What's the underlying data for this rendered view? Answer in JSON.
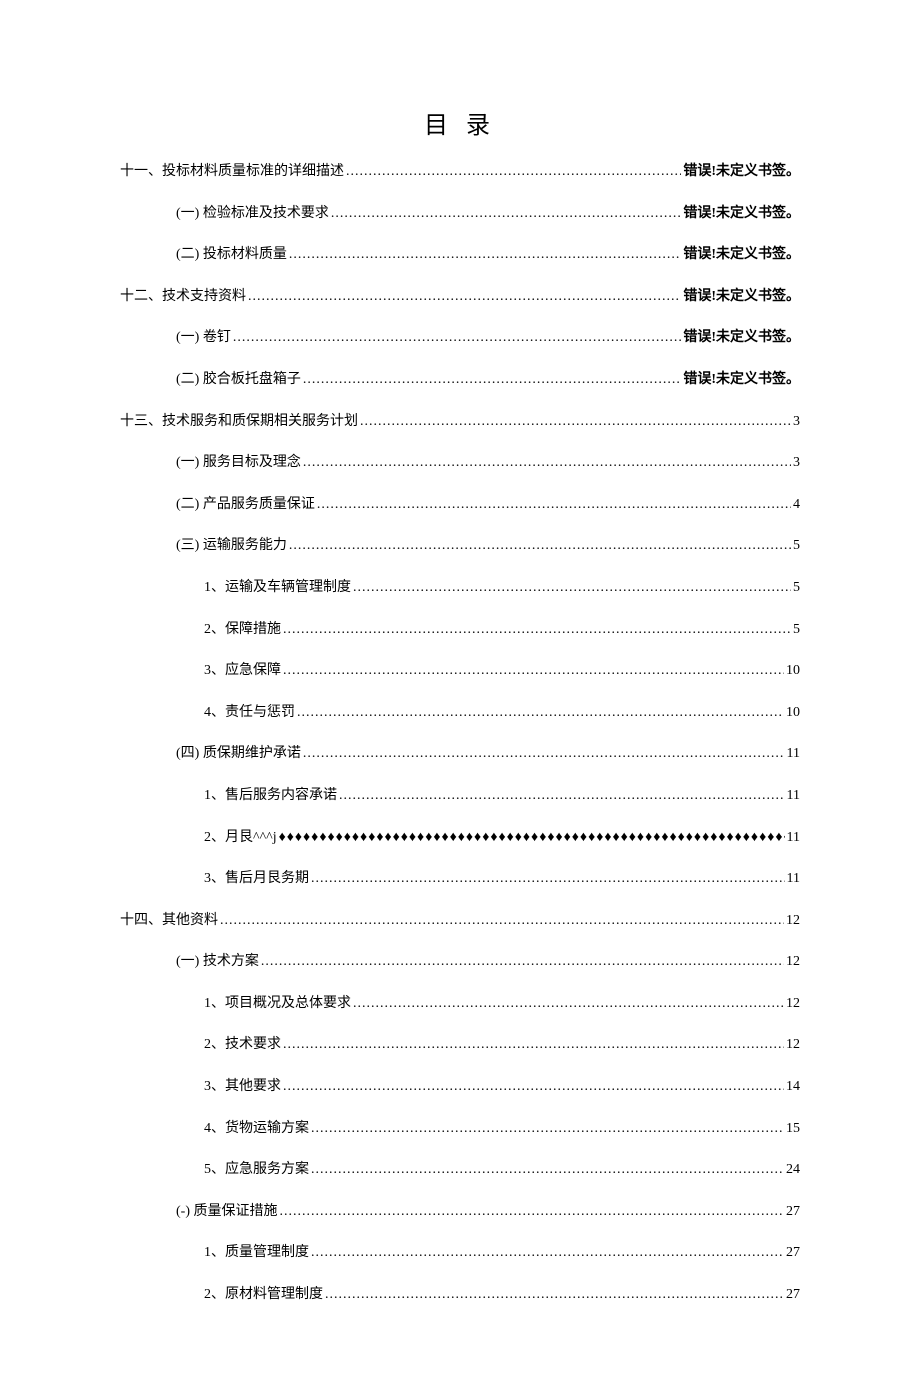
{
  "title": "目 录",
  "entries": [
    {
      "level": 1,
      "label": "十一、投标材料质量标准的详细描述",
      "page": "错误!未定义书签。",
      "boldPage": true,
      "space": true
    },
    {
      "level": 2,
      "label": "(一) 检验标准及技术要求",
      "page": "错误!未定义书签。",
      "boldPage": true
    },
    {
      "level": 2,
      "label": "(二) 投标材料质量",
      "page": "错误!未定义书签。",
      "boldPage": true
    },
    {
      "level": 1,
      "label": "十二、技术支持资料",
      "page": "错误!未定义书签。",
      "boldPage": true
    },
    {
      "level": 2,
      "label": "(一) 卷钉",
      "page": "错误!未定义书签。",
      "boldPage": true,
      "space": true
    },
    {
      "level": 2,
      "label": "(二) 胶合板托盘箱子",
      "page": "错误!未定义书签。",
      "boldPage": true,
      "space": true
    },
    {
      "level": 1,
      "label": "十三、技术服务和质保期相关服务计划",
      "page": "3"
    },
    {
      "level": 2,
      "label": "(一) 服务目标及理念",
      "page": "3"
    },
    {
      "level": 2,
      "label": "(二) 产品服务质量保证",
      "page": "4",
      "space": true
    },
    {
      "level": 2,
      "label": "(三) 运输服务能力",
      "page": "5"
    },
    {
      "level": 3,
      "label": "1、运输及车辆管理制度",
      "page": "5"
    },
    {
      "level": 3,
      "label": "2、保障措施",
      "page": "5"
    },
    {
      "level": 3,
      "label": "3、应急保障",
      "page": "10"
    },
    {
      "level": 3,
      "label": "4、责任与惩罚",
      "page": "10"
    },
    {
      "level": 2,
      "label": "(四) 质保期维护承诺",
      "page": "11"
    },
    {
      "level": 3,
      "label": "1、售后服务内容承诺",
      "page": "11"
    },
    {
      "level": 3,
      "label": "2、月艮^^^j",
      "page": "11",
      "diamond": true,
      "space": true
    },
    {
      "level": 3,
      "label": "3、售后月艮务期",
      "page": "11"
    },
    {
      "level": 1,
      "label": "十四、其他资料",
      "page": "12"
    },
    {
      "level": 2,
      "label": "(一) 技术方案",
      "page": "12"
    },
    {
      "level": 3,
      "label": "1、项目概况及总体要求",
      "page": "12",
      "space": true
    },
    {
      "level": 3,
      "label": "2、技术要求",
      "page": "12"
    },
    {
      "level": 3,
      "label": "3、其他要求",
      "page": "14"
    },
    {
      "level": 3,
      "label": "4、货物运输方案",
      "page": "15"
    },
    {
      "level": 3,
      "label": "5、应急服务方案",
      "page": "24"
    },
    {
      "level": 2,
      "label": "(-) 质量保证措施",
      "page": "27",
      "space": true
    },
    {
      "level": 3,
      "label": "1、质量管理制度",
      "page": "27"
    },
    {
      "level": 3,
      "label": "2、原材料管理制度",
      "page": "27"
    }
  ]
}
